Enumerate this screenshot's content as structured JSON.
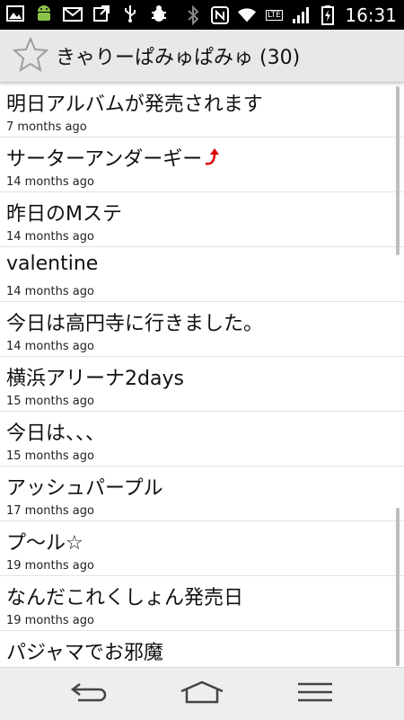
{
  "status_bar": {
    "left_icons": [
      "gallery-icon",
      "android-icon",
      "mail-icon",
      "upload-icon",
      "usb-icon",
      "bug-icon"
    ],
    "right_icons": [
      "bluetooth-icon",
      "nfc-icon",
      "wifi-icon",
      "lte-icon",
      "signal-icon",
      "battery-charging-icon"
    ],
    "lte_label": "LTE",
    "time": "16:31"
  },
  "action_bar": {
    "icon": "star-outline-icon",
    "title": "きゃりーぱみゅぱみゅ (30)"
  },
  "list": {
    "items": [
      {
        "title": "明日アルバムが発売されます",
        "time": "7 months ago"
      },
      {
        "title": "サーターアンダーギー",
        "time": "14 months ago",
        "has_arrow": true
      },
      {
        "title": "昨日のMステ",
        "time": "14 months ago"
      },
      {
        "title": "valentine",
        "time": "14 months ago"
      },
      {
        "title": "今日は高円寺に行きました。",
        "time": "14 months ago"
      },
      {
        "title": "横浜アリーナ2days",
        "time": "15 months ago"
      },
      {
        "title": "今日は、、、",
        "time": "15 months ago"
      },
      {
        "title": "アッシュパープル",
        "time": "17 months ago"
      },
      {
        "title": "プ〜ル☆",
        "time": "19 months ago"
      },
      {
        "title": "なんだこれくしょん発売日",
        "time": "19 months ago"
      },
      {
        "title": "パジャマでお邪魔",
        "time": ""
      }
    ]
  },
  "nav_bar": {
    "buttons": [
      "back-icon",
      "home-icon",
      "menu-icon"
    ]
  },
  "colors": {
    "status_bar_bg": "#000000",
    "action_bar_bg": "#e8e8e8",
    "arrow_accent": "#e00000",
    "nav_bar_bg": "#eceef0"
  }
}
